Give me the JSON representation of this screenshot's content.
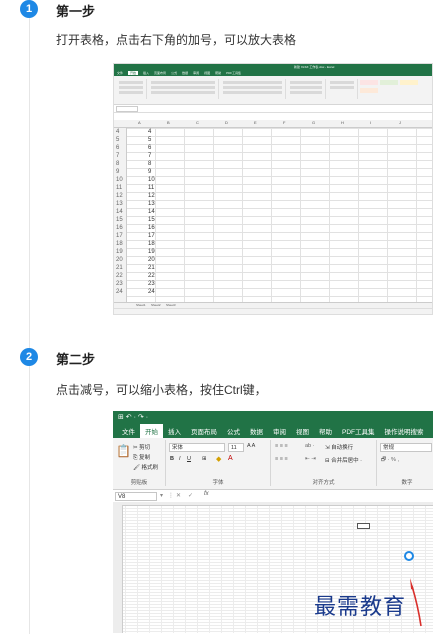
{
  "steps": [
    {
      "number": "1",
      "title": "第一步",
      "desc": "打开表格，点击右下角的加号，可以放大表格"
    },
    {
      "number": "2",
      "title": "第二步",
      "desc": "点击减号，可以缩小表格，按住Ctrl键，"
    }
  ],
  "shot1": {
    "window_title": "新建 XLSX 工作表.xlsx - Excel",
    "tabs": [
      "文件",
      "开始",
      "插入",
      "页面布局",
      "公式",
      "数据",
      "审阅",
      "视图",
      "帮助",
      "PDF工具集"
    ],
    "active_tab": "开始",
    "columns": [
      "A",
      "B",
      "C",
      "D",
      "E",
      "F",
      "G",
      "H",
      "I",
      "J"
    ],
    "rows": [
      {
        "n": "4",
        "v": "4"
      },
      {
        "n": "5",
        "v": "5"
      },
      {
        "n": "6",
        "v": "6"
      },
      {
        "n": "7",
        "v": "7"
      },
      {
        "n": "8",
        "v": "8"
      },
      {
        "n": "9",
        "v": "9"
      },
      {
        "n": "10",
        "v": "10"
      },
      {
        "n": "11",
        "v": "11"
      },
      {
        "n": "12",
        "v": "12"
      },
      {
        "n": "13",
        "v": "13"
      },
      {
        "n": "14",
        "v": "14"
      },
      {
        "n": "15",
        "v": "15"
      },
      {
        "n": "16",
        "v": "16"
      },
      {
        "n": "17",
        "v": "17"
      },
      {
        "n": "18",
        "v": "18"
      },
      {
        "n": "19",
        "v": "19"
      },
      {
        "n": "20",
        "v": "20"
      },
      {
        "n": "21",
        "v": "21"
      },
      {
        "n": "22",
        "v": "22"
      },
      {
        "n": "23",
        "v": "23"
      },
      {
        "n": "24",
        "v": "24"
      }
    ],
    "sheets": [
      "Sheet1",
      "Sheet2",
      "Sheet3"
    ]
  },
  "shot2": {
    "qa": "⊞ ↶ · ↷ ·",
    "tabs": [
      "文件",
      "开始",
      "插入",
      "页面布局",
      "公式",
      "数据",
      "审阅",
      "视图",
      "帮助",
      "PDF工具集",
      "操作说明搜索"
    ],
    "active_tab": "开始",
    "clipboard": {
      "cut": "剪切",
      "copy": "复制",
      "format_painter": "格式刷",
      "label": "剪贴板"
    },
    "font": {
      "name": "宋体",
      "size": "11",
      "label": "字体",
      "bold": "B",
      "italic": "I",
      "underline": "U"
    },
    "align": {
      "wrap": "自动换行",
      "merge": "合并后居中",
      "label": "对齐方式"
    },
    "number": {
      "format": "常规",
      "label": "数字"
    },
    "namebox": "V8",
    "fx": "fx"
  },
  "watermark": "最需教育",
  "colors": {
    "accent": "#1e88e5",
    "excel_green": "#217346",
    "watermark": "#1a3a8c",
    "arrow": "#d9302c"
  }
}
